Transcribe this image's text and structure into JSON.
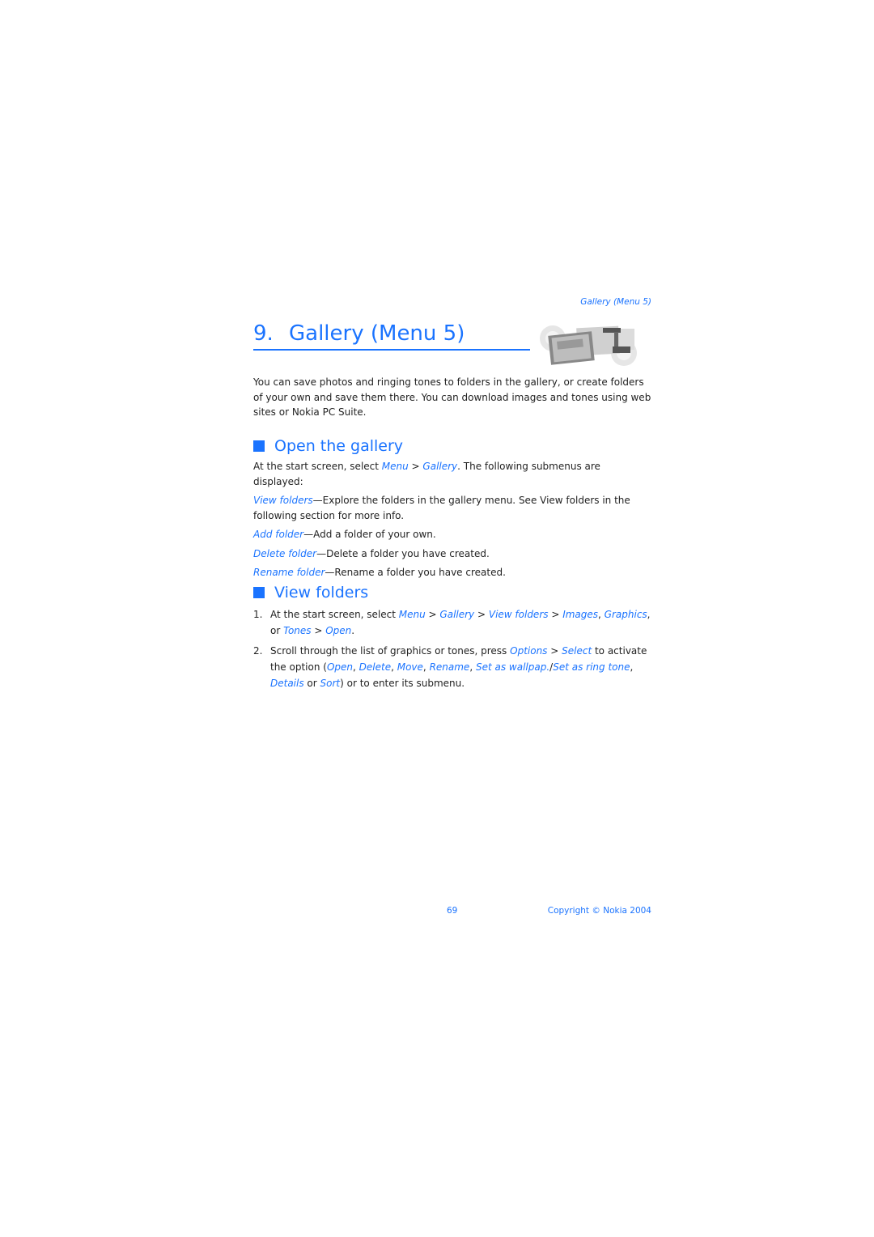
{
  "running_header": "Gallery (Menu 5)",
  "chapter": {
    "number": "9.",
    "title": "Gallery (Menu 5)",
    "art_icon": "gallery-photos-icon"
  },
  "intro": "You can save photos and ringing tones to folders in the gallery, or create folders of your own and save them there. You can download images and tones using web sites or Nokia PC Suite.",
  "sections": [
    {
      "heading": "Open the gallery",
      "lead_prefix": "At the start screen, select ",
      "lead_link1": "Menu",
      "lead_sep": " > ",
      "lead_link2": "Gallery",
      "lead_suffix": ". The following submenus are displayed:",
      "items": [
        {
          "term": "View folders",
          "desc": "—Explore the folders in the gallery menu. See View folders in the following section for more info."
        },
        {
          "term": "Add folder",
          "desc": "—Add a folder of your own."
        },
        {
          "term": "Delete folder",
          "desc": "—Delete a folder you have created."
        },
        {
          "term": "Rename folder",
          "desc": "—Rename a folder you have created."
        }
      ]
    },
    {
      "heading": "View folders",
      "steps": [
        {
          "n": "1.",
          "t1": "At the start screen, select ",
          "l1": "Menu",
          "s1": " > ",
          "l2": "Gallery",
          "s2": " > ",
          "l3": "View folders",
          "s3": " > ",
          "l4": "Images",
          "s4": ", ",
          "l5": "Graphics",
          "s5": ", or ",
          "l6": "Tones",
          "s6": " > ",
          "l7": "Open",
          "end": "."
        },
        {
          "n": "2.",
          "t1": "Scroll through the list of graphics or tones, press ",
          "l1": "Options",
          "s1": " > ",
          "l2": "Select",
          "s2": " to activate the option (",
          "l3": "Open",
          "s3": ", ",
          "l4": "Delete",
          "s4": ", ",
          "l5": "Move",
          "s5": ", ",
          "l6": "Rename",
          "s6": ", ",
          "l7": "Set as wallpap.",
          "s7": "/",
          "l8": "Set as ring tone",
          "s8": ", ",
          "l9": "Details",
          "s9": " or ",
          "l10": "Sort",
          "end": ") or to enter its submenu."
        }
      ]
    }
  ],
  "footer": {
    "page_number": "69",
    "copyright": "Copyright © Nokia 2004"
  },
  "colors": {
    "accent": "#1a73ff",
    "text": "#222222"
  }
}
